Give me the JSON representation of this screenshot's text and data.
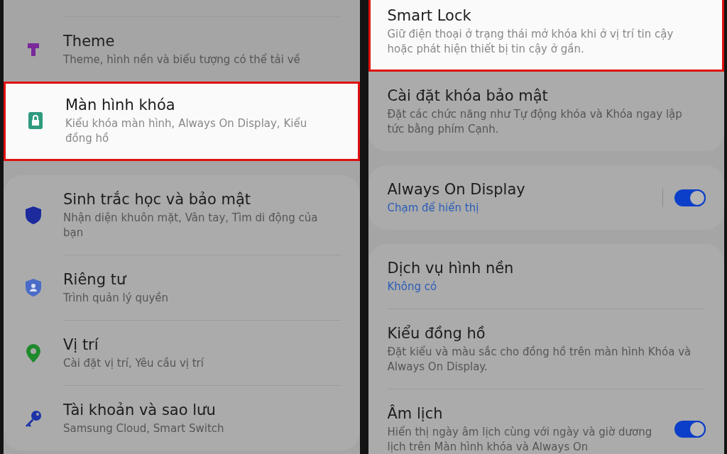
{
  "panels": [
    {
      "groups": [
        {
          "items": [
            {
              "title": "Theme",
              "subtitle": "Theme, hình nền và biểu tượng có thể tải về",
              "subtitle_link": false,
              "highlighted": false
            },
            {
              "title": "Màn hình khóa",
              "subtitle": "Kiểu khóa màn hình, Always On Display, Kiểu đồng hồ",
              "subtitle_link": false,
              "highlighted": true
            }
          ]
        },
        {
          "items": [
            {
              "title": "Sinh trắc học và bảo mật",
              "subtitle": "Nhận diện khuôn mặt, Vân tay, Tìm di động của bạn",
              "subtitle_link": false,
              "highlighted": false
            },
            {
              "title": "Riêng tư",
              "subtitle": "Trình quản lý quyền",
              "subtitle_link": false,
              "highlighted": false
            },
            {
              "title": "Vị trí",
              "subtitle": "Cài đặt vị trí, Yêu cầu vị trí",
              "subtitle_link": false,
              "highlighted": false
            },
            {
              "title": "Tài khoản và sao lưu",
              "subtitle": "Samsung Cloud, Smart Switch",
              "subtitle_link": false,
              "highlighted": false
            }
          ]
        }
      ]
    },
    {
      "groups": [
        {
          "items": [
            {
              "title": "Smart Lock",
              "subtitle": "Giữ điện thoại ở trạng thái mở khóa khi ở vị trí tin cậy hoặc phát hiện thiết bị tin cậy ở gần.",
              "subtitle_link": false,
              "highlighted": true
            },
            {
              "title": "Cài đặt khóa bảo mật",
              "subtitle": "Đặt các chức năng như Tự động khóa và Khóa ngay lập tức bằng phím Cạnh.",
              "subtitle_link": false,
              "highlighted": false
            }
          ]
        },
        {
          "items": [
            {
              "title": "Always On Display",
              "subtitle": "Chạm để hiển thị",
              "subtitle_link": true,
              "highlighted": false,
              "toggle": {
                "on": true
              }
            }
          ]
        },
        {
          "items": [
            {
              "title": "Dịch vụ hình nền",
              "subtitle": "Không có",
              "subtitle_link": true,
              "highlighted": false
            },
            {
              "title": "Kiểu đồng hồ",
              "subtitle": "Đặt kiểu và màu sắc cho đồng hồ trên màn hình Khóa và Always On Display.",
              "subtitle_link": false,
              "highlighted": false
            },
            {
              "title": "Âm lịch",
              "subtitle": "Hiển thị ngày âm lịch cùng với ngày và giờ dương lịch trên Màn hình khóa và Always On",
              "subtitle_link": false,
              "highlighted": false,
              "toggle": {
                "on": true
              }
            }
          ]
        }
      ]
    }
  ]
}
